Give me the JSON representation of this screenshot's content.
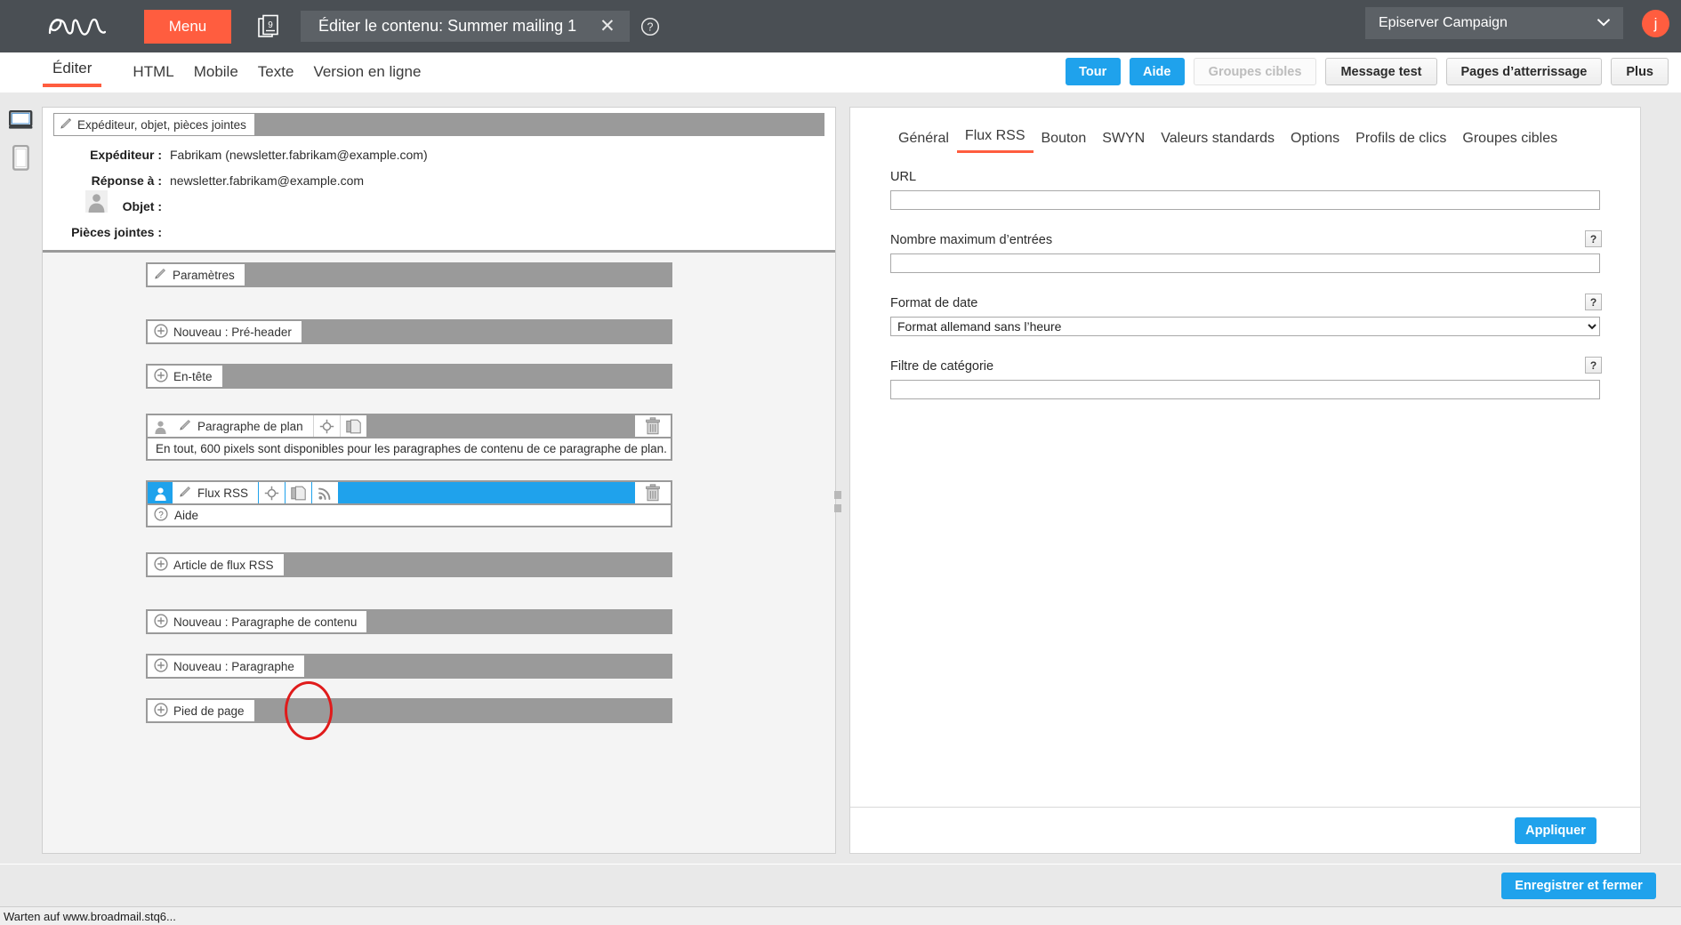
{
  "topbar": {
    "logo_icon": "episerver-logo",
    "menu_label": "Menu",
    "documents_icon": "documents-stack-icon",
    "tab_title": "Éditer le contenu: Summer mailing 1",
    "tab_close_icon": "close-icon",
    "tab_close_glyph": "✕",
    "help_icon": "question-circle-icon",
    "env_label": "Episerver Campaign",
    "env_chevron_icon": "chevron-down-icon",
    "avatar_initial": "j",
    "accent_orange": "#ff5d3f",
    "bar_background": "#4a4f54"
  },
  "toolbar": {
    "view_tabs": [
      {
        "label": "Éditer",
        "active": true
      },
      {
        "label": "HTML",
        "active": false
      },
      {
        "label": "Mobile",
        "active": false
      },
      {
        "label": "Texte",
        "active": false
      },
      {
        "label": "Version en ligne",
        "active": false
      }
    ],
    "buttons": [
      {
        "label": "Tour",
        "style": "primary",
        "id": "btn-tour"
      },
      {
        "label": "Aide",
        "style": "primary",
        "id": "btn-aide"
      },
      {
        "label": "Groupes cibles",
        "style": "disabled",
        "id": "btn-groupes"
      },
      {
        "label": "Message test",
        "style": "default",
        "id": "btn-message-test"
      },
      {
        "label": "Pages d’atterrissage",
        "style": "default",
        "id": "btn-landing"
      },
      {
        "label": "Plus",
        "style": "default",
        "id": "btn-plus"
      }
    ],
    "primary_color": "#1fa2ec"
  },
  "device_rail": {
    "desktop_icon": "desktop-monitor-icon",
    "mobile_icon": "mobile-phone-icon"
  },
  "editor": {
    "header_bar": {
      "pencil_icon": "pencil-edit-icon",
      "label": "Expéditeur, objet, pièces jointes"
    },
    "fields": [
      {
        "label": "Expéditeur :",
        "value": "Fabrikam (newsletter.fabrikam@example.com)"
      },
      {
        "label": "Réponse à :",
        "value": "newsletter.fabrikam@example.com"
      },
      {
        "label": "Objet :",
        "value": ""
      },
      {
        "label": "Pièces jointes :",
        "value": ""
      }
    ],
    "avatar_placeholder_icon": "user-silhouette-icon",
    "blocks": [
      {
        "kind": "settings",
        "label": "Paramètres",
        "lead_icon": "pencil-edit-icon",
        "has_user": false,
        "tools": [],
        "trash": false,
        "info": null
      },
      {
        "kind": "new",
        "label": "Nouveau : Pré-header",
        "lead_icon": "plus-circle-icon",
        "has_user": false,
        "tools": [],
        "trash": false,
        "info": null
      },
      {
        "kind": "new",
        "label": "En-tête",
        "lead_icon": "plus-circle-icon",
        "has_user": false,
        "tools": [],
        "trash": false,
        "info": null
      },
      {
        "kind": "content",
        "label": "Paragraphe de plan",
        "lead_icon": "pencil-edit-icon",
        "has_user": true,
        "tools": [
          "move-crosshair-icon",
          "copy-pages-icon"
        ],
        "trash": true,
        "trash_icon": "trash-can-icon",
        "info": "En tout, 600 pixels sont disponibles pour les paragraphes de contenu de ce paragraphe de plan.",
        "info_icon": null,
        "selected": false
      },
      {
        "kind": "content",
        "label": "Flux RSS",
        "lead_icon": "pencil-edit-icon",
        "has_user": true,
        "tools": [
          "move-crosshair-icon",
          "copy-pages-icon",
          "rss-feed-icon"
        ],
        "trash": true,
        "trash_icon": "trash-can-icon",
        "info": "Aide",
        "info_icon": "question-circle-icon",
        "selected": true
      },
      {
        "kind": "new",
        "label": "Article de flux RSS",
        "lead_icon": "plus-circle-icon",
        "has_user": false,
        "tools": [],
        "trash": false,
        "info": null
      },
      {
        "kind": "new",
        "label": "Nouveau : Paragraphe de contenu",
        "lead_icon": "plus-circle-icon",
        "has_user": false,
        "tools": [],
        "trash": false,
        "info": null
      },
      {
        "kind": "new",
        "label": "Nouveau : Paragraphe",
        "lead_icon": "plus-circle-icon",
        "has_user": false,
        "tools": [],
        "trash": false,
        "info": null
      },
      {
        "kind": "new",
        "label": "Pied de page",
        "lead_icon": "plus-circle-icon",
        "has_user": false,
        "tools": [],
        "trash": false,
        "info": null
      }
    ],
    "selected_color": "#1fa2ec",
    "bar_gray": "#9a9a9a",
    "annotation": {
      "shape": "ellipse",
      "color": "#e01b1b",
      "target_icon": "rss-feed-icon"
    }
  },
  "splitter": {
    "handle_icon": "resize-handle-icon"
  },
  "properties": {
    "tabs": [
      {
        "label": "Général",
        "active": false
      },
      {
        "label": "Flux RSS",
        "active": true
      },
      {
        "label": "Bouton",
        "active": false
      },
      {
        "label": "SWYN",
        "active": false
      },
      {
        "label": "Valeurs standards",
        "active": false
      },
      {
        "label": "Options",
        "active": false
      },
      {
        "label": "Profils de clics",
        "active": false
      },
      {
        "label": "Groupes cibles",
        "active": false
      }
    ],
    "fields": [
      {
        "label": "URL",
        "type": "text",
        "value": "",
        "placeholder": "",
        "help": false
      },
      {
        "label": "Nombre maximum d’entrées",
        "type": "text",
        "value": "",
        "placeholder": "",
        "help": true,
        "help_glyph": "?"
      },
      {
        "label": "Format de date",
        "type": "select",
        "value": "Format allemand sans l’heure",
        "help": true,
        "help_glyph": "?",
        "options": [
          "Format allemand sans l’heure"
        ]
      },
      {
        "label": "Filtre de catégorie",
        "type": "text",
        "value": "",
        "placeholder": "",
        "help": true,
        "help_glyph": "?"
      }
    ],
    "apply_label": "Appliquer"
  },
  "bottom": {
    "save_label": "Enregistrer et fermer"
  },
  "status": {
    "text": "Warten auf www.broadmail.stq6..."
  }
}
